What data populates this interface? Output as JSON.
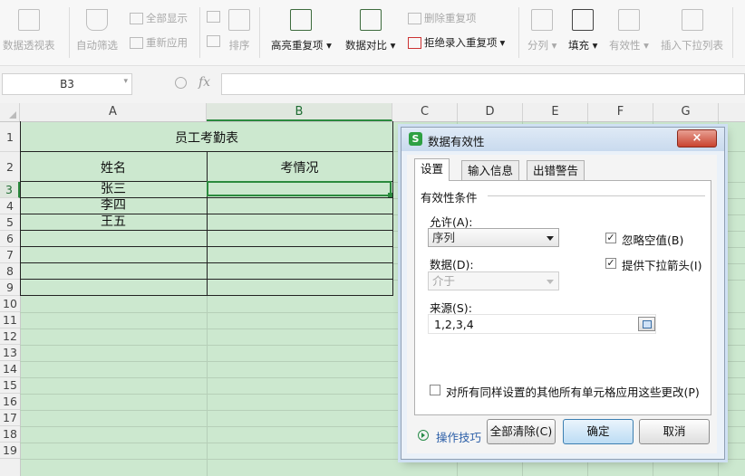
{
  "ribbon": {
    "pivot_label": "数据透视表",
    "autofilter_label": "自动筛选",
    "show_all_label": "全部显示",
    "reapply_label": "重新应用",
    "sort_label": "排序",
    "highlight_dup_label": "高亮重复项",
    "compare_label": "数据对比",
    "remove_dup_label": "删除重复项",
    "reject_dup_label": "拒绝录入重复项",
    "split_label": "分列",
    "fill_label": "填充",
    "validity_label": "有效性",
    "insert_dropdown_label": "插入下拉列表"
  },
  "formula_bar": {
    "name_box": "B3",
    "fx": "fx",
    "formula": ""
  },
  "sheet": {
    "columns": [
      "A",
      "B",
      "C",
      "D",
      "E",
      "F",
      "G"
    ],
    "rows": [
      "1",
      "2",
      "3",
      "4",
      "5",
      "6",
      "7",
      "8",
      "9",
      "10",
      "11",
      "12",
      "13",
      "14",
      "15",
      "16",
      "17",
      "18",
      "19"
    ],
    "title": "员工考勤表",
    "header_name": "姓名",
    "header_status": "考情况",
    "names": [
      "张三",
      "李四",
      "王五"
    ],
    "active_cell": "B3"
  },
  "dialog": {
    "title": "数据有效性",
    "close": "×",
    "tabs": [
      "设置",
      "输入信息",
      "出错警告"
    ],
    "group_label": "有效性条件",
    "allow_label": "允许(A):",
    "allow_value": "序列",
    "ignore_blank_label": "忽略空值(B)",
    "ignore_blank_checked": true,
    "data_label": "数据(D):",
    "data_value": "介于",
    "dropdown_label": "提供下拉箭头(I)",
    "dropdown_checked": true,
    "source_label": "来源(S):",
    "source_value": "1,2,3,4",
    "apply_all_label": "对所有同样设置的其他所有单元格应用这些更改(P)",
    "apply_all_checked": false,
    "tips_label": "操作技巧",
    "clear_label": "全部清除(C)",
    "ok_label": "确定",
    "cancel_label": "取消"
  }
}
